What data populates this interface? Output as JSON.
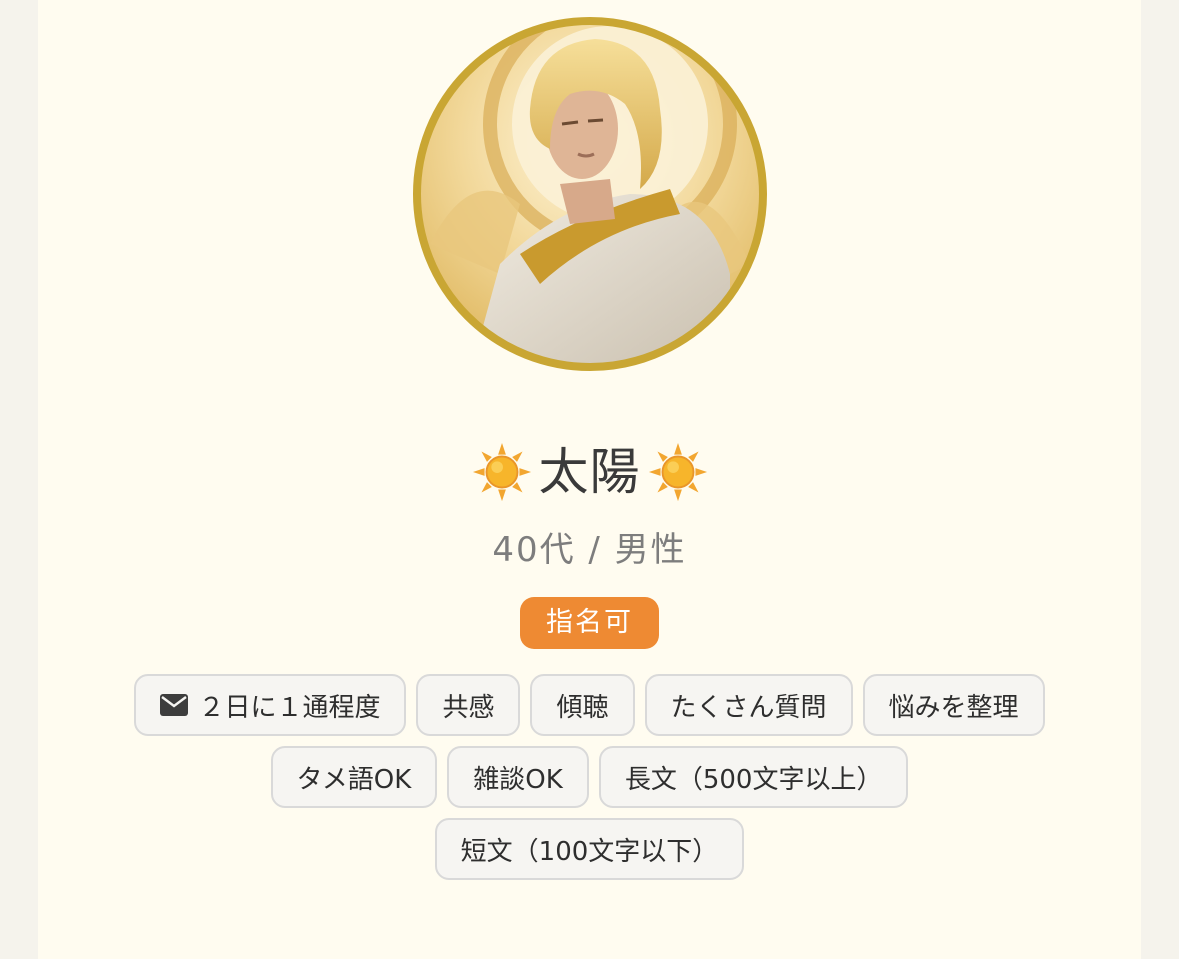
{
  "profile": {
    "avatar_alt": "太陽",
    "name": "太陽",
    "name_prefix_icon": "sun-icon",
    "name_suffix_icon": "sun-icon",
    "meta": "40代 / 男性",
    "badge": "指名可"
  },
  "tags": {
    "row1": [
      {
        "icon": "mail-icon",
        "label": "２日に１通程度"
      },
      {
        "label": "共感"
      },
      {
        "label": "傾聴"
      },
      {
        "label": "たくさん質問"
      },
      {
        "label": "悩みを整理"
      }
    ],
    "row2": [
      {
        "label": "タメ語OK"
      },
      {
        "label": "雑談OK"
      },
      {
        "label": "長文（500文字以上）"
      }
    ],
    "row3": [
      {
        "label": "短文（100文字以下）"
      }
    ]
  },
  "colors": {
    "page_background": "#fffcf0",
    "badge_background": "#ee8a33",
    "avatar_border": "#c9a633",
    "tag_border": "#d9d9d9"
  }
}
